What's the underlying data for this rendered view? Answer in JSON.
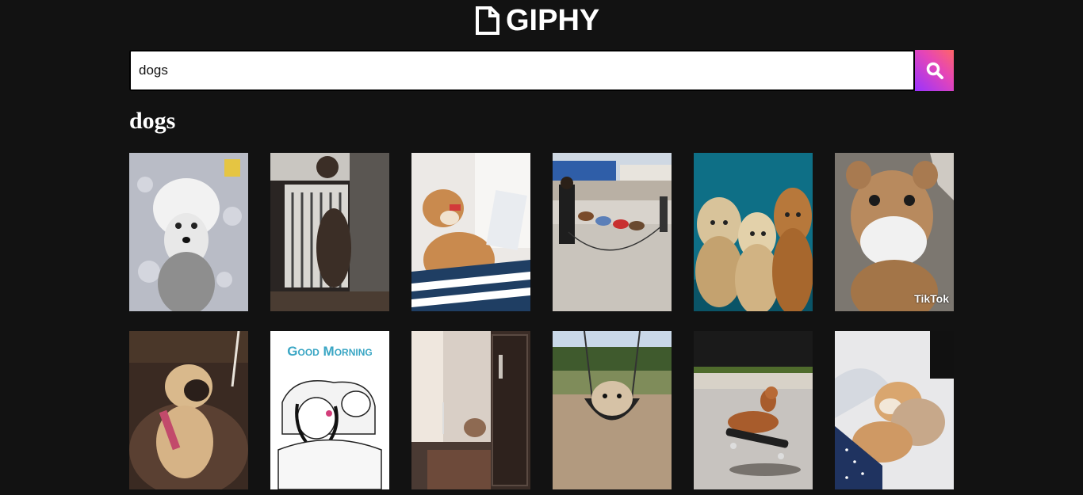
{
  "header": {
    "logo_text": "GIPHY",
    "logo_icon": "giphy-logo-icon"
  },
  "search": {
    "value": "dogs",
    "button_icon": "search-icon",
    "button_gradient": [
      "#9933ff",
      "#ff6666"
    ]
  },
  "results": {
    "title": "dogs",
    "gifs": [
      {
        "icon": "fluffy-white-dog-gif"
      },
      {
        "icon": "dog-at-window-gif"
      },
      {
        "icon": "shiba-laptop-gif"
      },
      {
        "icon": "dogs-jump-rope-gif"
      },
      {
        "icon": "three-hound-dogs-gif"
      },
      {
        "icon": "bulldog-face-mask-gif",
        "overlay": "TikTok"
      },
      {
        "icon": "pug-on-couch-gif"
      },
      {
        "icon": "good-morning-cartoon-gif",
        "overlay": "Good Morning"
      },
      {
        "icon": "dog-in-dark-room-gif"
      },
      {
        "icon": "dog-on-swing-gif"
      },
      {
        "icon": "dachshund-skateboard-gif"
      },
      {
        "icon": "puppies-in-bed-gif"
      }
    ]
  },
  "colors": {
    "background": "#121212",
    "text": "#ffffff"
  }
}
